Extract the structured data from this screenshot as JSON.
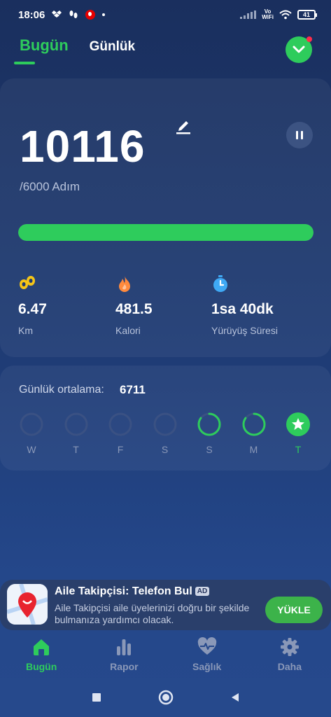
{
  "status_bar": {
    "time": "18:06",
    "network_label": "Vo\nWiFi",
    "battery": "41"
  },
  "header": {
    "tabs": [
      {
        "label": "Bugün",
        "active": true
      },
      {
        "label": "Günlük",
        "active": false
      }
    ],
    "dropdown_icon": "chevron-down-icon",
    "has_notification": true
  },
  "today": {
    "steps": "10116",
    "goal_text": "/6000 Adım",
    "progress_fraction": 1.0,
    "stats": [
      {
        "icon": "footprints-icon",
        "value": "6.47",
        "label": "Km"
      },
      {
        "icon": "flame-icon",
        "value": "481.5",
        "label": "Kalori"
      },
      {
        "icon": "stopwatch-icon",
        "value": "1sa 40dk",
        "label": "Yürüyüş Süresi"
      }
    ]
  },
  "daily_average": {
    "label": "Günlük ortalama:",
    "value": "6711",
    "days": [
      {
        "label": "W",
        "progress": 0,
        "completed": false
      },
      {
        "label": "T",
        "progress": 0,
        "completed": false
      },
      {
        "label": "F",
        "progress": 0,
        "completed": false
      },
      {
        "label": "S",
        "progress": 0,
        "completed": false
      },
      {
        "label": "S",
        "progress": 0.85,
        "completed": false
      },
      {
        "label": "M",
        "progress": 0.85,
        "completed": false
      },
      {
        "label": "T",
        "progress": 1.0,
        "completed": true
      }
    ]
  },
  "ad": {
    "title": "Aile Takipçisi: Telefon Bul",
    "badge": "AD",
    "description": "Aile Takipçisi aile üyelerinizi doğru bir şekilde bulmanıza yardımcı olacak.",
    "button": "YÜKLE"
  },
  "bottom_nav": [
    {
      "label": "Bugün",
      "icon": "home-icon",
      "active": true
    },
    {
      "label": "Rapor",
      "icon": "bar-chart-icon",
      "active": false
    },
    {
      "label": "Sağlık",
      "icon": "heartbeat-icon",
      "active": false
    },
    {
      "label": "Daha",
      "icon": "gear-icon",
      "active": false
    }
  ],
  "colors": {
    "accent": "#2ecc5c",
    "background_top": "#1a2f5e",
    "background_bottom": "#26498c",
    "muted_text": "#8a98b8",
    "flame": "#ff8a3d",
    "footprints": "#f5c518",
    "stopwatch": "#3fa9f5"
  }
}
